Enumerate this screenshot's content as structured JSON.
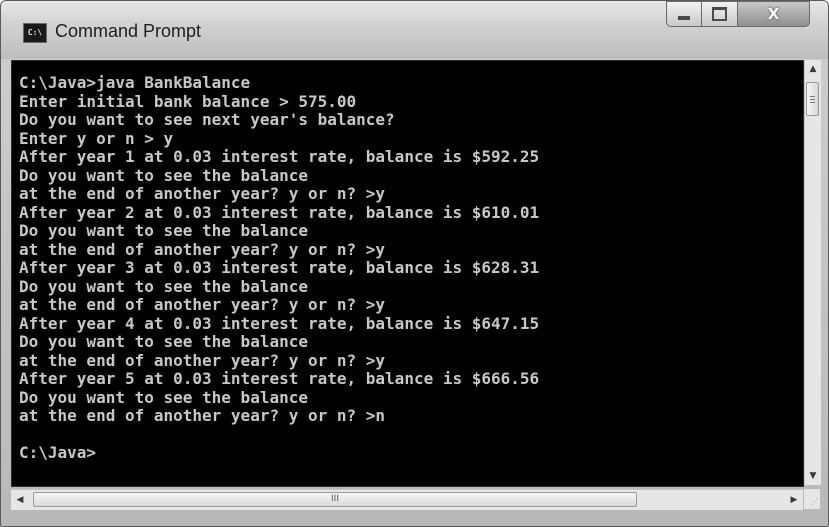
{
  "window": {
    "title": "Command Prompt",
    "app_icon": "cmd-icon",
    "app_icon_text": "C:\\"
  },
  "caption_buttons": {
    "minimize_icon": "minimize-icon",
    "maximize_icon": "maximize-icon",
    "close_icon": "close-icon",
    "close_glyph": "X"
  },
  "console": {
    "background": "#000000",
    "foreground": "#c8c8c8",
    "lines": [
      "C:\\Java>java BankBalance",
      "Enter initial bank balance > 575.00",
      "Do you want to see next year's balance?",
      "Enter y or n > y",
      "After year 1 at 0.03 interest rate, balance is $592.25",
      "Do you want to see the balance",
      "at the end of another year? y or n? >y",
      "After year 2 at 0.03 interest rate, balance is $610.01",
      "Do you want to see the balance",
      "at the end of another year? y or n? >y",
      "After year 3 at 0.03 interest rate, balance is $628.31",
      "Do you want to see the balance",
      "at the end of another year? y or n? >y",
      "After year 4 at 0.03 interest rate, balance is $647.15",
      "Do you want to see the balance",
      "at the end of another year? y or n? >y",
      "After year 5 at 0.03 interest rate, balance is $666.56",
      "Do you want to see the balance",
      "at the end of another year? y or n? >n",
      "",
      "C:\\Java>"
    ]
  },
  "scrollbars": {
    "up_arrow": "▲",
    "down_arrow": "▼",
    "left_arrow": "◀",
    "right_arrow": "▶",
    "h_thumb_grip": "III"
  }
}
